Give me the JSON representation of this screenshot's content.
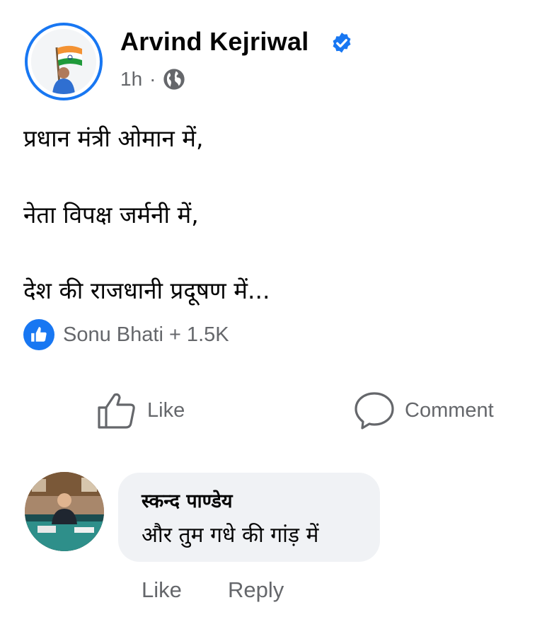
{
  "post": {
    "author": "Arvind Kejriwal",
    "time": "1h",
    "separator": "·",
    "lines": [
      "प्रधान मंत्री ओमान में,",
      "नेता विपक्ष जर्मनी में,",
      "देश की राजधानी प्रदूषण में..."
    ],
    "reactions_text": "Sonu Bhati + 1.5K"
  },
  "actions": {
    "like": "Like",
    "comment": "Comment"
  },
  "comment": {
    "author": "स्कन्द पाण्डेय",
    "text": "और तुम गधे की गांड़ में",
    "like": "Like",
    "reply": "Reply"
  },
  "colors": {
    "brand_blue": "#1877f2",
    "secondary_text": "#65676b",
    "bubble_bg": "#f0f2f5"
  },
  "icons": [
    "verified-badge-icon",
    "globe-icon",
    "like-reaction-icon",
    "thumbs-up-icon",
    "comment-icon"
  ]
}
